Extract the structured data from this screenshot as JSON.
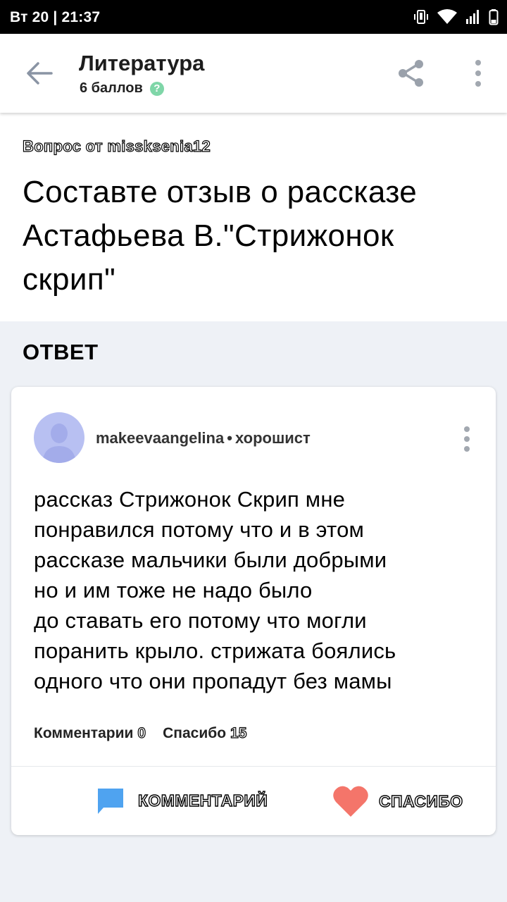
{
  "status_bar": {
    "time": "Вт 20 | 21:37",
    "icons": [
      "vibrate-icon",
      "wifi-icon",
      "signal-icon",
      "battery-icon"
    ]
  },
  "app_bar": {
    "subject": "Литература",
    "points": "6 баллов",
    "help_glyph": "?",
    "icons": [
      "back-arrow-icon",
      "share-icon",
      "more-vert-icon"
    ]
  },
  "question": {
    "asker": "Вопрос от missksenia12",
    "text": "Составте отзыв о рассказе Астафьева В.\"Стрижонок скрип\""
  },
  "answer_section": {
    "heading": "ОТВЕТ"
  },
  "answer": {
    "author": "makeevaangelina",
    "separator": "•",
    "rank": "хорошист",
    "text": "рассказ Стрижонок Скрип мне\nпонравился потому что и в этом\nрассказе мальчики были добрыми\nно и им тоже не надо было\nдо ставать его потому что могли\nпоранить крыло. стрижата боялись\nодного что они пропадут без мамы",
    "comments_label": "Комментарии",
    "comments_count": "0",
    "thanks_label": "Спасибо",
    "thanks_count": "15",
    "comment_button": "КОММЕНТАРИЙ",
    "thanks_button": "СПАСИБО"
  },
  "colors": {
    "background": "#eef1f6",
    "avatar": "#b8c0f2",
    "help_icon": "#7fd6a8",
    "comment_icon": "#4fa3f0",
    "heart_icon": "#f4756a",
    "muted_icon": "#a2a8b0"
  }
}
